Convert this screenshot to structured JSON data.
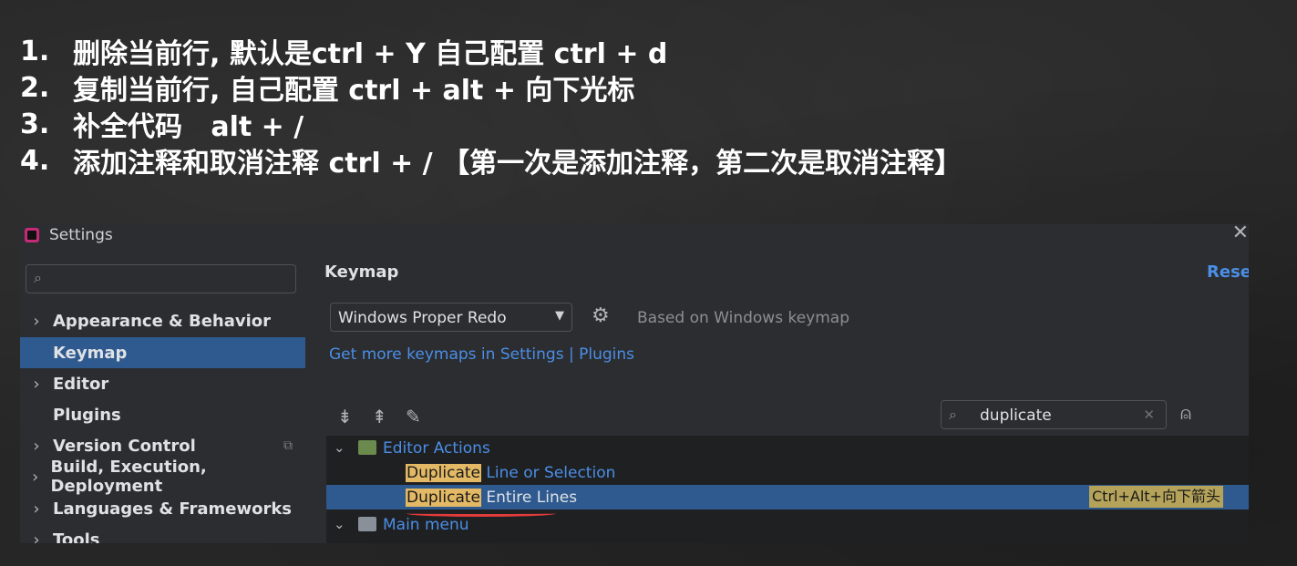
{
  "notes": [
    {
      "num": "1.",
      "text": "删除当前行, 默认是ctrl + Y 自己配置 ctrl + d"
    },
    {
      "num": "2.",
      "text": "复制当前行, 自己配置 ctrl + alt + 向下光标"
    },
    {
      "num": "3.",
      "text": "补全代码   alt + /"
    },
    {
      "num": "4.",
      "text": "添加注释和取消注释 ctrl + / 【第一次是添加注释，第二次是取消注释】"
    }
  ],
  "window": {
    "title": "Settings",
    "close_glyph": "✕"
  },
  "sidebar": {
    "search_placeholder": "",
    "items": [
      {
        "label": "Appearance & Behavior",
        "expandable": true
      },
      {
        "label": "Keymap",
        "expandable": false,
        "selected": true
      },
      {
        "label": "Editor",
        "expandable": true
      },
      {
        "label": "Plugins",
        "expandable": false
      },
      {
        "label": "Version Control",
        "expandable": true,
        "badge": "⧉"
      },
      {
        "label": "Build, Execution, Deployment",
        "expandable": true
      },
      {
        "label": "Languages & Frameworks",
        "expandable": true
      },
      {
        "label": "Tools",
        "expandable": true
      }
    ]
  },
  "main": {
    "title": "Keymap",
    "reset_label": "Reset",
    "keymap_select": "Windows Proper Redo",
    "based_on": "Based on Windows keymap",
    "get_more_link": "Get more keymaps in Settings | Plugins",
    "filter_value": "duplicate"
  },
  "tree": {
    "group1": "Editor Actions",
    "row1_highlight": "Duplicate",
    "row1_rest": " Line or Selection",
    "row2_highlight": "Duplicate",
    "row2_rest": " Entire Lines",
    "row2_shortcut": "Ctrl+Alt+向下箭头",
    "group2": "Main menu"
  },
  "colors": {
    "accent": "#4b8ee6",
    "selection": "#2e5a8f",
    "highlight": "#e3b965",
    "annotation": "#e23b3b"
  },
  "icons": [
    "search-icon",
    "gear-icon",
    "expand-all-icon",
    "collapse-all-icon",
    "edit-icon",
    "find-shortcut-icon",
    "close-icon",
    "chevron-right-icon",
    "chevron-down-icon"
  ]
}
